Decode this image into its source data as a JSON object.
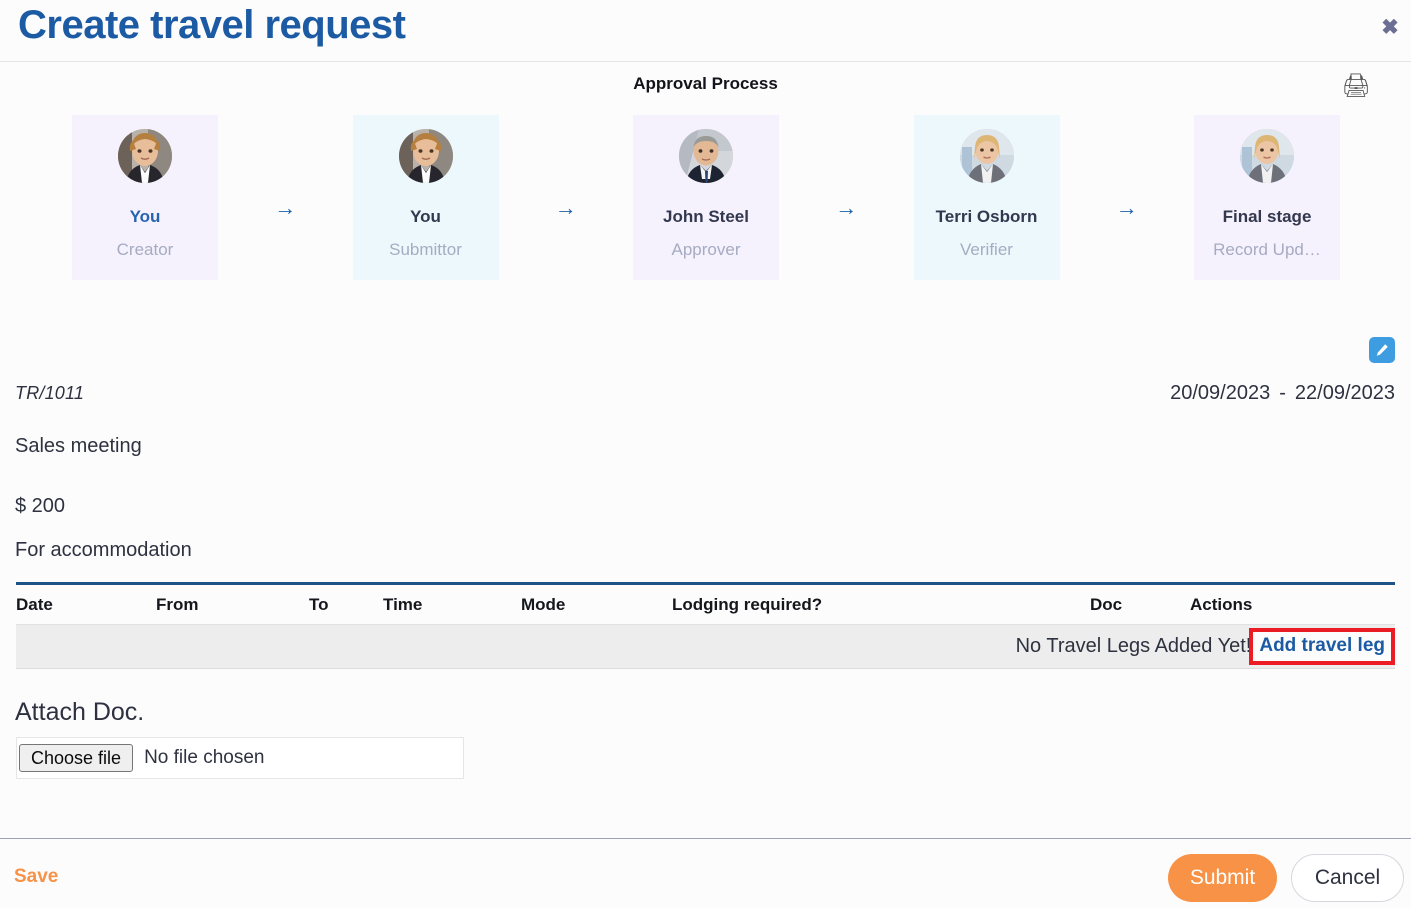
{
  "header": {
    "title": "Create travel request",
    "close_icon": "close-icon",
    "close_glyph": "✖"
  },
  "approval": {
    "title": "Approval Process",
    "print_icon": "printer-icon",
    "print_glyph": "🖨",
    "arrow_glyph": "→",
    "stages": [
      {
        "name": "You",
        "role": "Creator",
        "avatar": "woman-blonde-dark-blazer",
        "bg": "#f5f2fd",
        "accent": true
      },
      {
        "name": "You",
        "role": "Submittor",
        "avatar": "woman-blonde-dark-blazer",
        "bg": "#edf8fd",
        "accent": false
      },
      {
        "name": "John Steel",
        "role": "Approver",
        "avatar": "man-grey-hair-suit",
        "bg": "#f5f2fd",
        "accent": false
      },
      {
        "name": "Terri Osborn",
        "role": "Verifier",
        "avatar": "woman-blonde-grey-blazer",
        "bg": "#edf8fd",
        "accent": false
      },
      {
        "name": "Final stage",
        "role": "Record Upd…",
        "avatar": "woman-blonde-grey-blazer",
        "bg": "#f5f2fd",
        "accent": false
      }
    ]
  },
  "request": {
    "edit_icon": "pencil-icon",
    "id": "TR/1011",
    "date_from": "20/09/2023",
    "date_separator": "-",
    "date_to": "22/09/2023",
    "purpose": "Sales meeting",
    "amount": "$ 200",
    "amount_note": "For accommodation"
  },
  "legs_table": {
    "columns": [
      "Date",
      "From",
      "To",
      "Time",
      "Mode",
      "Lodging required?",
      "Doc",
      "Actions"
    ],
    "rows": [],
    "empty_message": "No Travel Legs Added Yet!",
    "add_leg_label": "Add travel leg",
    "highlight_color": "#ec1c24"
  },
  "attachment": {
    "label": "Attach Doc.",
    "choose_file_label": "Choose file",
    "no_file_text": "No file chosen"
  },
  "footer": {
    "save_label": "Save",
    "submit_label": "Submit",
    "cancel_label": "Cancel",
    "accent_color": "#f79246"
  }
}
